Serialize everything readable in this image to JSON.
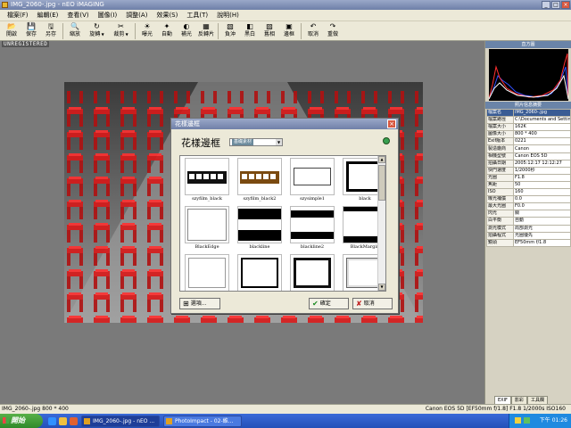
{
  "window": {
    "title": "IMG_2060-.jpg - nEO iMAGING"
  },
  "menu": [
    "檔案(F)",
    "編輯(E)",
    "查看(V)",
    "圖像(I)",
    "調整(A)",
    "效果(S)",
    "工具(T)",
    "說明(H)"
  ],
  "toolbar": [
    {
      "label": "開啟",
      "icon": "open-icon",
      "glyph": "📂"
    },
    {
      "label": "保存",
      "icon": "save-icon",
      "glyph": "💾"
    },
    {
      "label": "另存",
      "icon": "save-as-icon",
      "glyph": "🖫"
    },
    {
      "label": "縮放",
      "icon": "zoom-icon",
      "glyph": "🔍"
    },
    {
      "label": "旋轉",
      "icon": "rotate-icon",
      "glyph": "↻",
      "dropdown": true
    },
    {
      "label": "裁剪",
      "icon": "crop-icon",
      "glyph": "✂",
      "dropdown": true
    },
    {
      "label": "曝光",
      "icon": "exposure-icon",
      "glyph": "☀"
    },
    {
      "label": "自動",
      "icon": "auto-icon",
      "glyph": "✦"
    },
    {
      "label": "補光",
      "icon": "fill-light-icon",
      "glyph": "◐"
    },
    {
      "label": "反轉片",
      "icon": "slide-film-icon",
      "glyph": "▦"
    },
    {
      "label": "負沖",
      "icon": "cross-process-icon",
      "glyph": "▧"
    },
    {
      "label": "黑白",
      "icon": "black-white-icon",
      "glyph": "◧"
    },
    {
      "label": "舊相",
      "icon": "old-photo-icon",
      "glyph": "▨"
    },
    {
      "label": "邊框",
      "icon": "frame-icon",
      "glyph": "▣"
    },
    {
      "label": "取消",
      "icon": "undo-icon",
      "glyph": "↶"
    },
    {
      "label": "重做",
      "icon": "redo-icon",
      "glyph": "↷"
    }
  ],
  "workspace": {
    "watermark": "UNREGISTERED"
  },
  "dialog": {
    "title": "花樣邊框",
    "heading": "花樣邊框",
    "category": "基礎素材",
    "items": [
      "szyfilm_black",
      "szyfilm_black2",
      "szysimple1",
      "black",
      "BlackEdge",
      "blackline",
      "blackline2",
      "BlackMargin",
      "",
      "",
      "",
      ""
    ],
    "options_label": "選項...",
    "ok_label": "確定",
    "cancel_label": "取消"
  },
  "right_panel": {
    "histogram_title": "直方圖",
    "info_title": "照片信息摘要",
    "info": [
      {
        "k": "檔案名",
        "v": "IMG_2060-.jpg"
      },
      {
        "k": "檔案路徑",
        "v": "C:\\Documents and Settings"
      },
      {
        "k": "檔案大小",
        "v": "162K"
      },
      {
        "k": "圖像大小",
        "v": "800 * 400"
      },
      {
        "k": "Exif版本",
        "v": "0221"
      },
      {
        "k": "製造廠商",
        "v": "Canon"
      },
      {
        "k": "相機型號",
        "v": "Canon EOS 5D"
      },
      {
        "k": "拍攝日期",
        "v": "2005:12:17 12:12:27"
      },
      {
        "k": "快門速度",
        "v": "1/2000秒"
      },
      {
        "k": "光圈",
        "v": "F1.8"
      },
      {
        "k": "焦距",
        "v": "50"
      },
      {
        "k": "ISO",
        "v": "160"
      },
      {
        "k": "曝光補償",
        "v": "0.0"
      },
      {
        "k": "最大光圈",
        "v": "F0.0"
      },
      {
        "k": "閃光",
        "v": "關"
      },
      {
        "k": "白平衡",
        "v": "自動"
      },
      {
        "k": "測光模式",
        "v": "局部測光"
      },
      {
        "k": "拍攝程式",
        "v": "光圈優先"
      },
      {
        "k": "鏡頭",
        "v": "EF50mm f/1.8"
      }
    ],
    "tabs": [
      "EXIF",
      "影彩",
      "工具欄"
    ]
  },
  "status": {
    "left": "IMG_2060-.jpg 800 * 400",
    "right": "Canon EOS 5D [EF50mm f/1.8] F1.8 1/2000s ISO160"
  },
  "taskbar": {
    "start_label": "開始",
    "tasks": [
      "IMG_2060-.jpg - nEO ...",
      "PhotoImpact - 02-維..."
    ],
    "clock": "下午 01:26"
  }
}
